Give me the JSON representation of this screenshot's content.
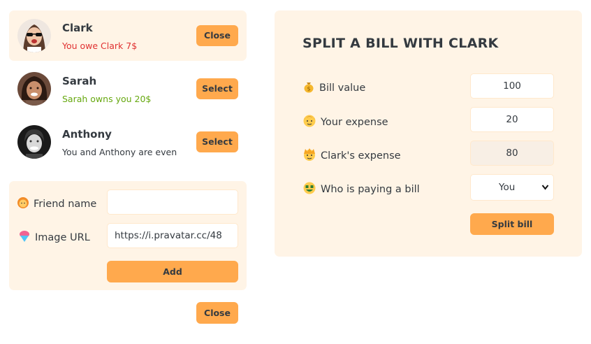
{
  "friends": [
    {
      "name": "Clark",
      "status": "You owe Clark 7$",
      "status_tone": "red",
      "button": "Close",
      "selected": true
    },
    {
      "name": "Sarah",
      "status": "Sarah owns you 20$",
      "status_tone": "green",
      "button": "Select",
      "selected": false
    },
    {
      "name": "Anthony",
      "status": "You and Anthony are even",
      "status_tone": "neutral",
      "button": "Select",
      "selected": false
    }
  ],
  "add_friend": {
    "name_label": "Friend name",
    "name_value": "",
    "name_icon": "woman-emoji",
    "image_label": "Image URL",
    "image_value": "https://i.pravatar.cc/48",
    "image_icon": "shaved-ice-emoji",
    "add_button": "Add"
  },
  "close_form_button": "Close",
  "split": {
    "title": "SPLIT A BILL WITH CLARK",
    "bill_label": "Bill value",
    "bill_icon": "money-bag-emoji",
    "bill_value": "100",
    "your_label": "Your expense",
    "your_icon": "person-emoji",
    "your_value": "20",
    "friend_label": "Clark's expense",
    "friend_icon": "person-curly-emoji",
    "friend_value": "80",
    "payer_label": "Who is paying a bill",
    "payer_icon": "money-mouth-emoji",
    "payer_value": "You",
    "submit_button": "Split bill"
  },
  "colors": {
    "accent": "#ffa94d",
    "panel": "#fff4e6",
    "owe": "#e03131",
    "owed": "#66a80f",
    "text": "#343a40"
  }
}
